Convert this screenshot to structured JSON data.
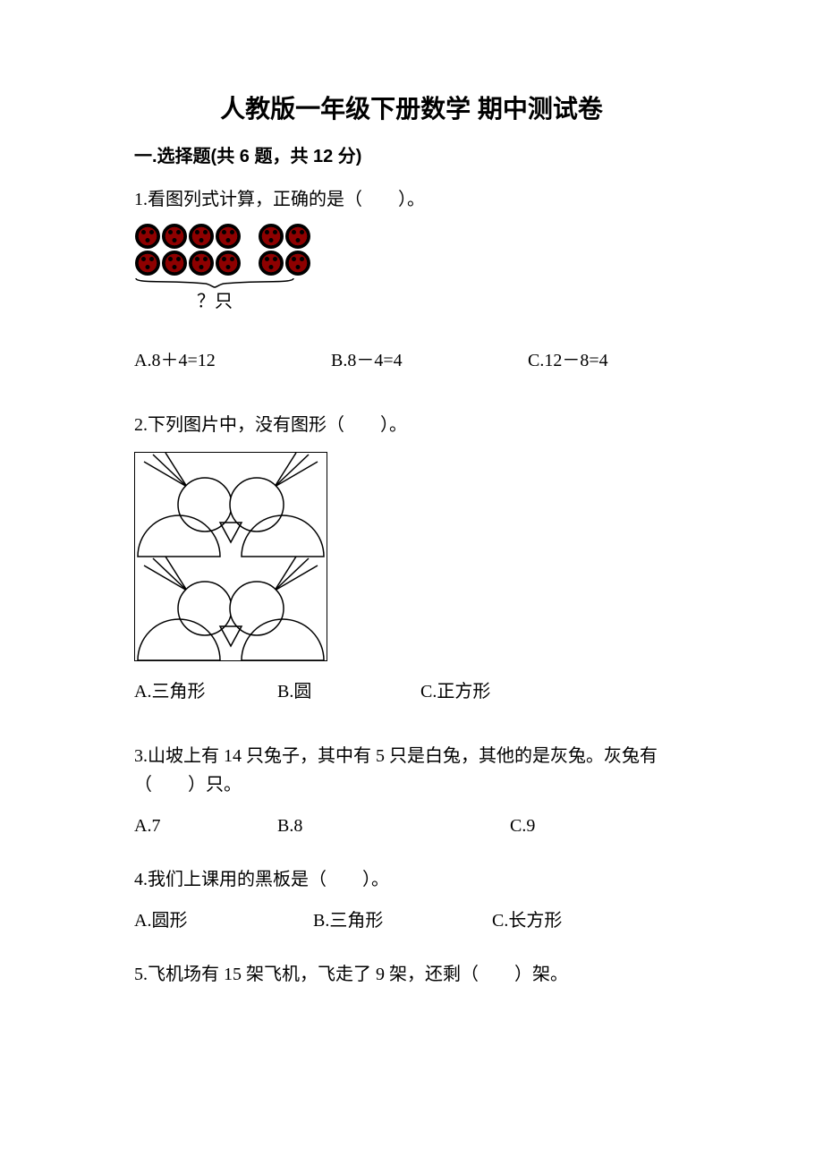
{
  "title": "人教版一年级下册数学 期中测试卷",
  "section1": {
    "heading": "一.选择题(共 6 题，共 12 分)",
    "q1": {
      "text": "1.看图列式计算，正确的是（　　）。",
      "bracket_label": "？只",
      "optA": "A.8＋4=12",
      "optB": "B.8－4=4",
      "optC": "C.12－8=4"
    },
    "q2": {
      "text": "2.下列图片中，没有图形（　　）。",
      "optA": "A.三角形",
      "optB": "B.圆",
      "optC": "C.正方形"
    },
    "q3": {
      "text": "3.山坡上有 14 只兔子，其中有 5 只是白兔，其他的是灰兔。灰兔有（　　）只。",
      "optA": "A.7",
      "optB": "B.8",
      "optC": "C.9"
    },
    "q4": {
      "text": "4.我们上课用的黑板是（　　）。",
      "optA": "A.圆形",
      "optB": "B.三角形",
      "optC": "C.长方形"
    },
    "q5": {
      "text": "5.飞机场有 15 架飞机，飞走了 9 架，还剩（　　）架。"
    }
  }
}
